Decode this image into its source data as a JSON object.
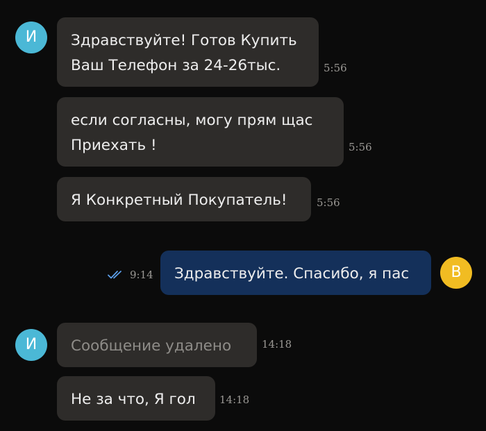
{
  "chat": {
    "incoming_avatar_letter": "И",
    "outgoing_avatar_letter": "В",
    "colors": {
      "background": "#0b0b0b",
      "incoming_bubble": "#2e2c2a",
      "outgoing_bubble": "#14305a",
      "incoming_avatar": "#4bb8d6",
      "outgoing_avatar": "#f1bc22",
      "read_ticks": "#5b9ee8"
    },
    "messages": [
      {
        "direction": "in",
        "text": "Здравствуйте! Готов Купить\nВаш Телефон за 24-26тыс.",
        "time": "5:56"
      },
      {
        "direction": "in",
        "text": "если согласны, могу прям щас\nПриехать !",
        "time": "5:56"
      },
      {
        "direction": "in",
        "text": "Я Конкретный Покупатель!",
        "time": "5:56"
      },
      {
        "direction": "out",
        "text": "Здравствуйте. Спасибо, я пас",
        "time": "9:14",
        "status_icon": "double-check-icon"
      },
      {
        "direction": "in",
        "text": "Сообщение удалено",
        "time": "14:18",
        "deleted": true
      },
      {
        "direction": "in",
        "text": "Не за что, Я гол",
        "time": "14:18"
      }
    ]
  }
}
